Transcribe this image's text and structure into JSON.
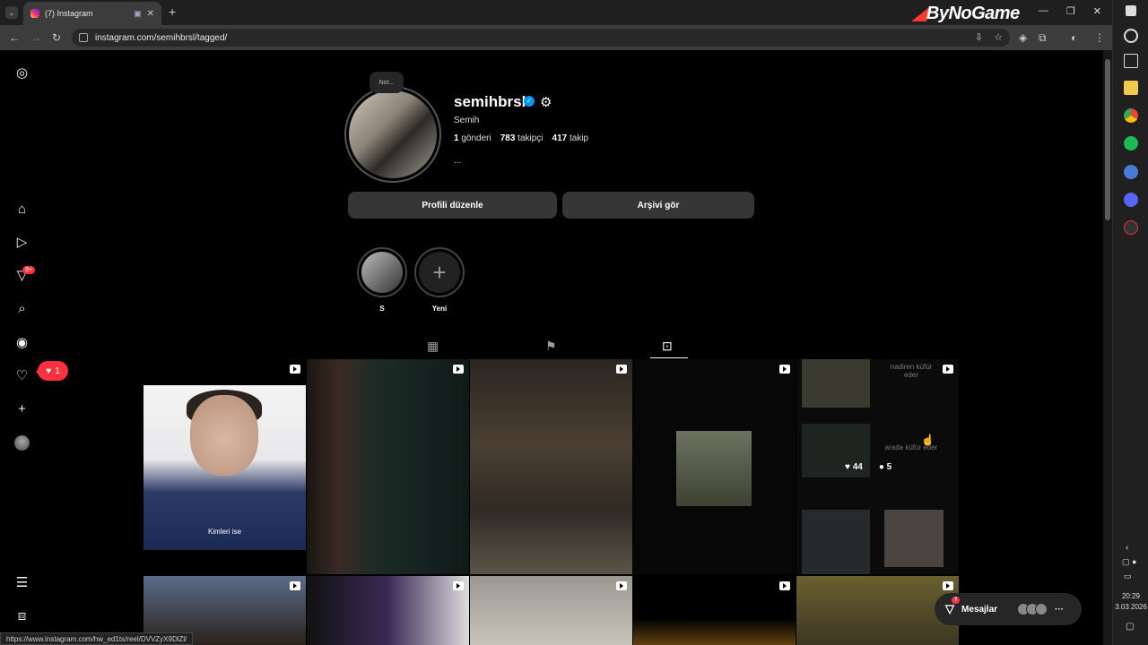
{
  "browser": {
    "tab_title": "(7) Instagram",
    "url": "instagram.com/semihbrsl/tagged/",
    "brand": "ByNoGame",
    "status_url": "https://www.instagram.com/hw_ed1ts/reel/DVVZyX9DlZl/"
  },
  "profile": {
    "note": "Not...",
    "username": "semihbrsl",
    "full_name": "Semih",
    "posts_count": "1",
    "posts_label": "gönderi",
    "followers_count": "783",
    "followers_label": "takipçi",
    "following_count": "417",
    "following_label": "takip",
    "bio": "...",
    "edit_button": "Profili düzenle",
    "archive_button": "Arşivi gör"
  },
  "highlights": [
    {
      "label": "S"
    },
    {
      "label": "Yeni"
    }
  ],
  "sidebar": {
    "notif_badge": "9+",
    "likes_count": "1"
  },
  "grid": {
    "cell1_caption": "Kimleri ise",
    "cell5_text1": "nadiren küfür eder",
    "cell5_text2": "arada küfür eder",
    "hover_likes": "44",
    "hover_comments": "5"
  },
  "messages": {
    "label": "Mesajlar",
    "badge": "7"
  },
  "taskbar": {
    "time": "20:29",
    "date": "3.03.2026"
  }
}
